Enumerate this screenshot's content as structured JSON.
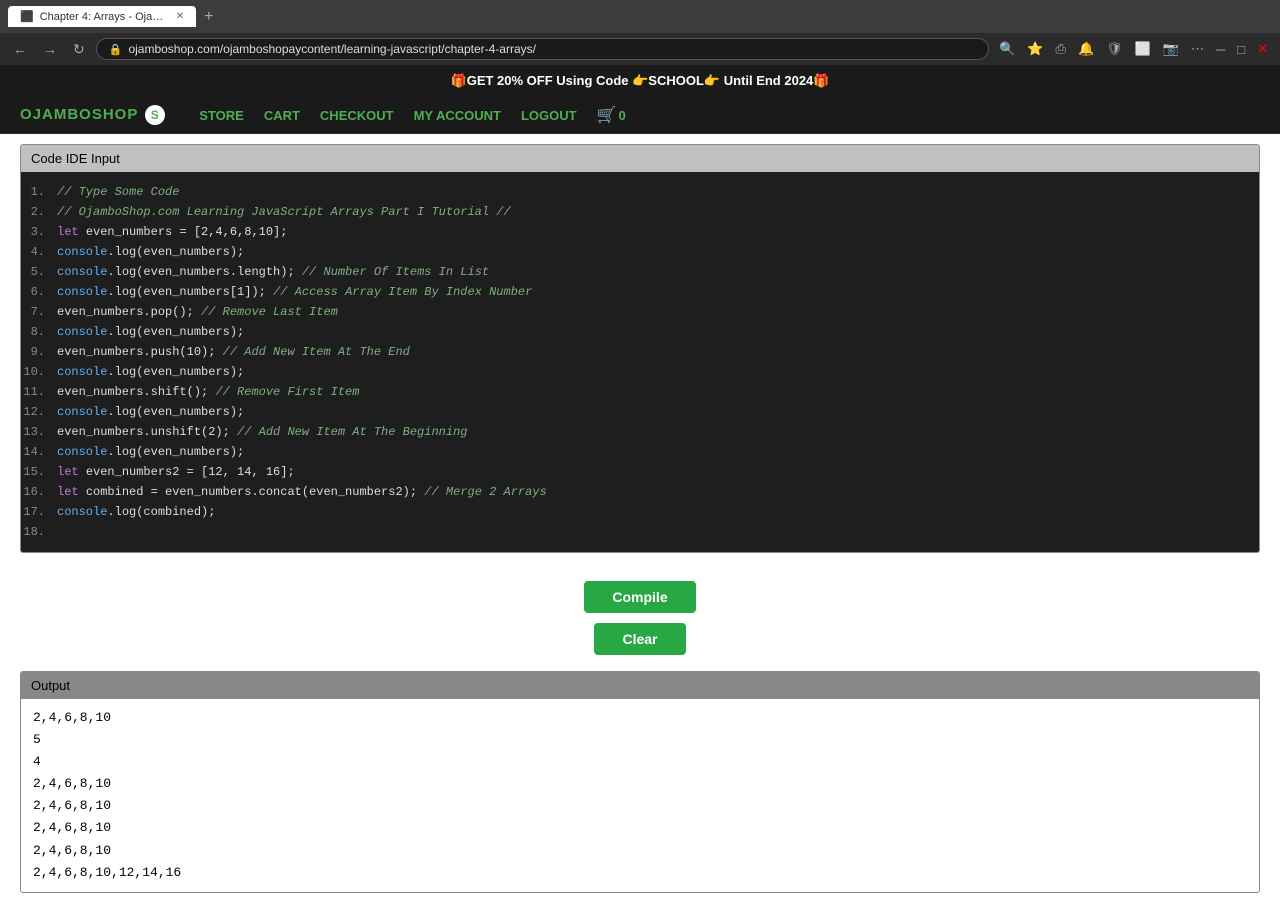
{
  "browser": {
    "tab_title": "Chapter 4: Arrays - Ojambo...",
    "url": "ojamboshop.com/ojamboshopaycontent/learning-javascript/chapter-4-arrays/"
  },
  "promo": {
    "text": "🎁GET 20% OFF Using Code 👉SCHOOL👉 Until End 2024🎁"
  },
  "navbar": {
    "brand": "OJAMBOSHOP",
    "brand_s": "S",
    "links": [
      {
        "label": "STORE",
        "name": "store-link"
      },
      {
        "label": "CART",
        "name": "cart-link"
      },
      {
        "label": "CHECKOUT",
        "name": "checkout-link"
      },
      {
        "label": "MY ACCOUNT",
        "name": "my-account-link"
      },
      {
        "label": "LOGOUT",
        "name": "logout-link"
      }
    ],
    "cart_count": "0"
  },
  "code_ide": {
    "header": "Code IDE Input",
    "lines": [
      {
        "num": "1.",
        "code": "// Type Some Code",
        "type": "comment"
      },
      {
        "num": "2.",
        "code": "// OjamboShop.com Learning JavaScript Arrays Part I Tutorial //",
        "type": "comment"
      },
      {
        "num": "3.",
        "code": "let even_numbers = [2,4,6,8,10];",
        "type": "let"
      },
      {
        "num": "4.",
        "code": "console.log(even_numbers);",
        "type": "console"
      },
      {
        "num": "5.",
        "code": "console.log(even_numbers.length); // Number Of Items In List",
        "type": "console_comment"
      },
      {
        "num": "6.",
        "code": "console.log(even_numbers[1]); // Access Array Item By Index Number",
        "type": "console_comment"
      },
      {
        "num": "7.",
        "code": "even_numbers.pop(); // Remove Last Item",
        "type": "method_comment"
      },
      {
        "num": "8.",
        "code": "console.log(even_numbers);",
        "type": "console"
      },
      {
        "num": "9.",
        "code": "even_numbers.push(10); // Add New Item At The End",
        "type": "method_comment"
      },
      {
        "num": "10.",
        "code": "console.log(even_numbers);",
        "type": "console"
      },
      {
        "num": "11.",
        "code": "even_numbers.shift(); // Remove First Item",
        "type": "method_comment"
      },
      {
        "num": "12.",
        "code": "console.log(even_numbers);",
        "type": "console"
      },
      {
        "num": "13.",
        "code": "even_numbers.unshift(2); // Add New Item At The Beginning",
        "type": "method_comment"
      },
      {
        "num": "14.",
        "code": "console.log(even_numbers);",
        "type": "console"
      },
      {
        "num": "15.",
        "code": "let even_numbers2 = [12, 14,  16];",
        "type": "let"
      },
      {
        "num": "16.",
        "code": "let combined = even_numbers.concat(even_numbers2); // Merge 2 Arrays",
        "type": "let_comment"
      },
      {
        "num": "17.",
        "code": "console.log(combined);",
        "type": "console"
      },
      {
        "num": "18.",
        "code": "",
        "type": "empty"
      }
    ]
  },
  "buttons": {
    "compile": "Compile",
    "clear": "Clear"
  },
  "output": {
    "header": "Output",
    "lines": [
      "2,4,6,8,10",
      "5",
      "4",
      "2,4,6,8,10",
      "2,4,6,8,10",
      "2,4,6,8,10",
      "2,4,6,8,10",
      "2,4,6,8,10,12,14,16"
    ]
  }
}
